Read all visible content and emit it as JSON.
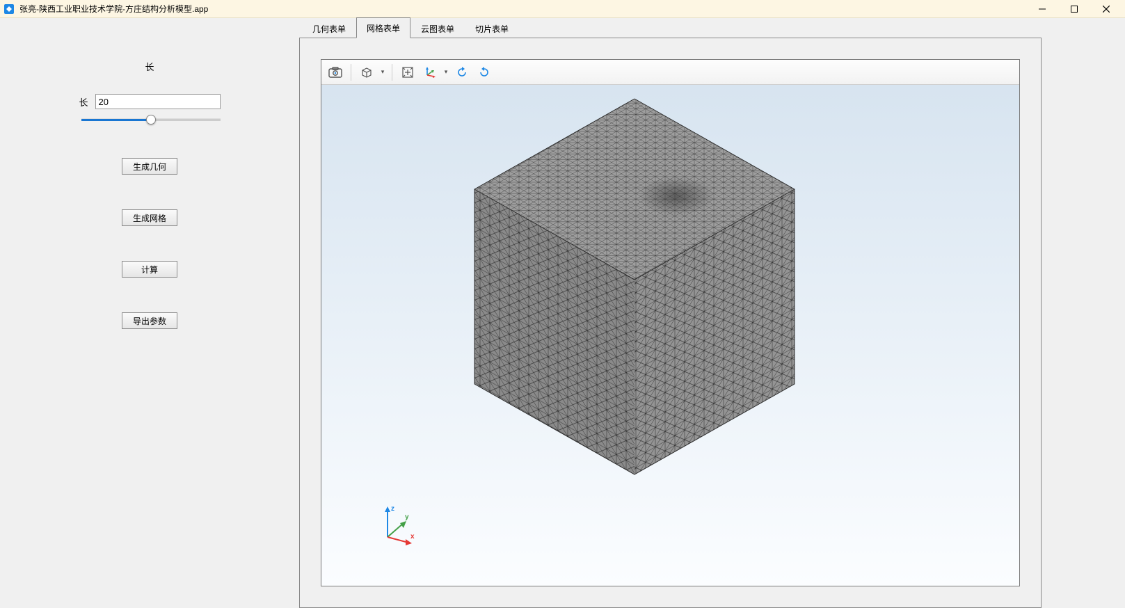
{
  "titlebar": {
    "title": "张亮-陕西工业职业技术学院-方庄结构分析模型.app"
  },
  "left_panel": {
    "section_label": "长",
    "length_label": "长",
    "length_value": "20",
    "slider_value": 50,
    "btn_generate_geometry": "生成几何",
    "btn_generate_mesh": "生成网格",
    "btn_compute": "计算",
    "btn_export_params": "导出参数"
  },
  "tabs": {
    "items": [
      {
        "label": "几何表单",
        "active": false
      },
      {
        "label": "网格表单",
        "active": true
      },
      {
        "label": "云图表单",
        "active": false
      },
      {
        "label": "切片表单",
        "active": false
      }
    ]
  },
  "toolbar_icons": {
    "screenshot": "screenshot-icon",
    "view_cube": "view-cube-icon",
    "zoom_extents": "zoom-extents-icon",
    "axis_orient": "axis-orient-icon",
    "rotate_ccw": "rotate-ccw-icon",
    "rotate_cw": "rotate-cw-icon"
  },
  "axis_labels": {
    "x": "x",
    "y": "y",
    "z": "z"
  },
  "colors": {
    "x_axis": "#e53935",
    "y_axis": "#43a047",
    "z_axis": "#1e88e5",
    "mesh_fill": "#9e9e9e",
    "mesh_line": "#2b2b2b"
  }
}
